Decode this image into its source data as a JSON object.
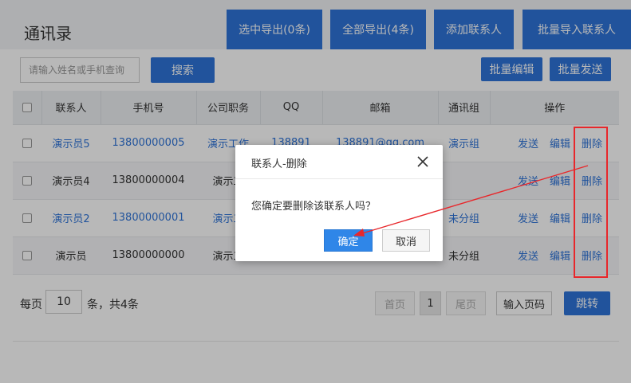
{
  "header": {
    "title": "通讯录",
    "buttons": [
      "选中导出(0条)",
      "全部导出(4条)",
      "添加联系人",
      "批量导入联系人"
    ]
  },
  "search": {
    "placeholder": "请输入姓名或手机查询",
    "button": "搜索",
    "batch_edit": "批量编辑",
    "batch_send": "批量发送"
  },
  "table": {
    "headers": [
      "联系人",
      "手机号",
      "公司职务",
      "QQ",
      "邮箱",
      "通讯组",
      "操作"
    ],
    "rows": [
      {
        "name": "演示员5",
        "phone": "13800000005",
        "job": "演示工作",
        "qq": "138891",
        "email": "138891@qq.com",
        "group": "演示组",
        "highlight": true
      },
      {
        "name": "演示员4",
        "phone": "13800000004",
        "job": "演示工",
        "qq": "",
        "email": "",
        "group": "",
        "highlight": false
      },
      {
        "name": "演示员2",
        "phone": "13800000001",
        "job": "演示工",
        "qq": "",
        "email": "",
        "group": "未分组",
        "highlight": true
      },
      {
        "name": "演示员",
        "phone": "13800000000",
        "job": "演示工",
        "qq": "",
        "email": "",
        "group": "未分组",
        "highlight": false
      }
    ],
    "ops": {
      "send": "发送",
      "edit": "编辑",
      "delete": "删除"
    }
  },
  "pager": {
    "prefix": "每页",
    "page_size": "10",
    "suffix": "条，共4条",
    "first": "首页",
    "current": "1",
    "last": "尾页",
    "input": "输入页码",
    "jump": "跳转"
  },
  "dialog": {
    "title": "联系人-删除",
    "message": "您确定要删除该联系人吗？",
    "ok": "确定",
    "cancel": "取消"
  },
  "colors": {
    "primary": "#2f74d8",
    "annotation": "#e8272b"
  }
}
